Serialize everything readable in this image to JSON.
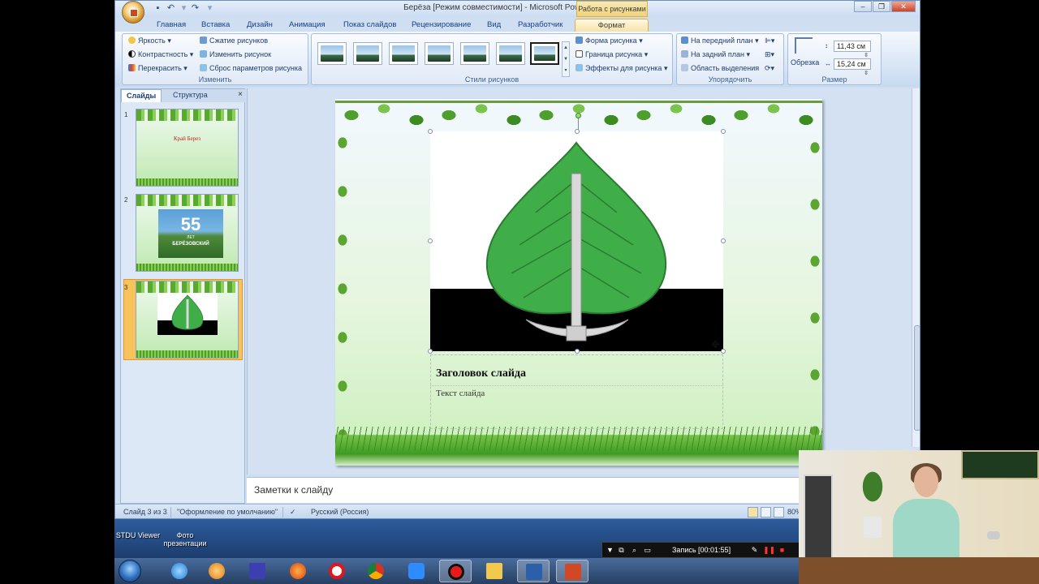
{
  "window": {
    "title": "Берёза [Режим совместимости] - Microsoft PowerPoint",
    "context_header": "Работа с рисунками"
  },
  "ribbon_tabs": [
    "Главная",
    "Вставка",
    "Дизайн",
    "Анимация",
    "Показ слайдов",
    "Рецензирование",
    "Вид",
    "Разработчик",
    "Формат"
  ],
  "groups": {
    "adjust": {
      "label": "Изменить",
      "items": [
        "Яркость",
        "Контрастность",
        "Перекрасить",
        "Сжатие рисунков",
        "Изменить рисунок",
        "Сброс параметров рисунка"
      ]
    },
    "styles": {
      "label": "Стили рисунков",
      "items": [
        "Форма рисунка",
        "Граница рисунка",
        "Эффекты для рисунка"
      ],
      "gallery_count": 7,
      "gallery_selected_index": 6
    },
    "arrange": {
      "label": "Упорядочить",
      "items": [
        "На передний план",
        "На задний план",
        "Область выделения"
      ]
    },
    "size": {
      "label": "Размер",
      "crop_label": "Обрезка",
      "height": "11,43 см",
      "width": "15,24 см"
    }
  },
  "left_panel": {
    "tabs": [
      "Слайды",
      "Структура"
    ],
    "close_symbol": "×",
    "slides": [
      {
        "number": "1",
        "text": "Край Берез"
      },
      {
        "number": "2",
        "banner_number": "55",
        "banner_sub": "ЛЕТ",
        "banner_text": "БЕРЁЗОВСКИЙ"
      },
      {
        "number": "3",
        "selected": true
      }
    ]
  },
  "slide": {
    "title": "Заголовок слайда",
    "body": "Текст слайда"
  },
  "notes": {
    "placeholder": "Заметки к слайду"
  },
  "status_bar": {
    "slide_info": "Слайд 3 из 3",
    "theme": "\"Оформление по умолчанию\"",
    "language": "Русский (Россия)",
    "zoom": "80%"
  },
  "desktop_icons": [
    {
      "label": "STDU Viewer"
    },
    {
      "label": "Фото презентации"
    }
  ],
  "recorder": {
    "text": "Запись [00:01:55]"
  },
  "taskbar": {
    "apps": [
      "internet-explorer",
      "media-player",
      "save-floppy",
      "firefox",
      "opera",
      "chrome",
      "zoom",
      "recorder",
      "explorer-folder",
      "word",
      "powerpoint"
    ]
  },
  "colors": {
    "ribbon_bg": "#dfe9f6",
    "leaf_green": "#3fae49",
    "flag_black": "#000000",
    "format_tab": "#f7e2a4"
  }
}
